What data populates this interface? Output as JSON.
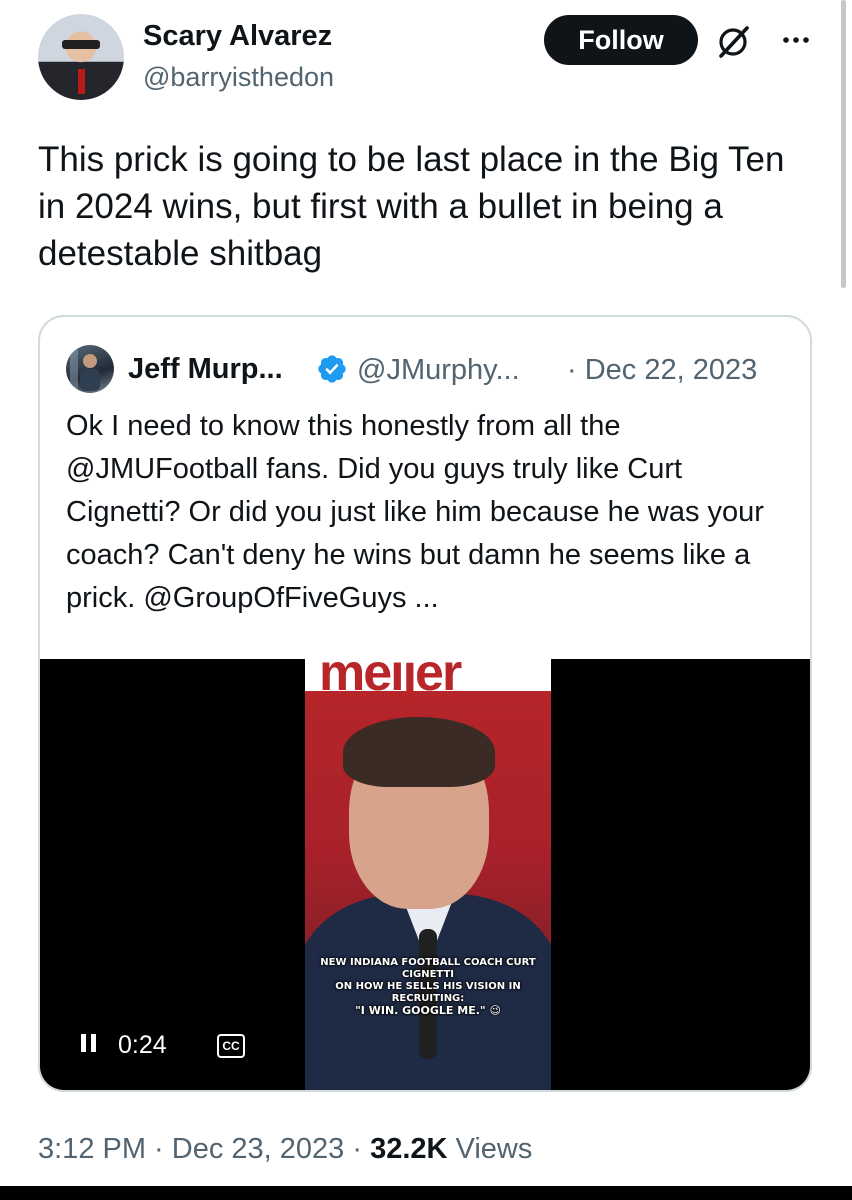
{
  "author": {
    "name": "Scary Alvarez",
    "handle": "@barryisthedon",
    "avatar_icon": "profile-photo-avatar"
  },
  "header_actions": {
    "follow_label": "Follow",
    "grok_icon": "grok-slash-circle-icon",
    "more_icon": "more-dots-icon"
  },
  "tweet": {
    "text": "This prick is going to be last place in the Big Ten in 2024 wins, but first with a bullet in being a detestable shitbag"
  },
  "quoted": {
    "name": "Jeff Murp...",
    "verified_icon": "verified-badge-icon",
    "handle": "@JMurphy...",
    "date": "· Dec 22, 2023",
    "text": "Ok I need to know this honestly from all the @JMUFootball fans. Did you guys truly like Curt Cignetti? Or did you just like him because he was your coach? Can't deny he wins but damn he seems like a prick.  @GroupOfFiveGuys ...",
    "video": {
      "banner_text": "meijer",
      "caption_line1": "NEW INDIANA FOOTBALL COACH CURT CIGNETTI",
      "caption_line2": "ON HOW HE SELLS HIS VISION IN RECRUITING:",
      "caption_line3": "\"I WIN. GOOGLE ME.\" 😉",
      "pause_icon": "pause-icon",
      "time": "0:24",
      "cc_label": "CC"
    }
  },
  "footer": {
    "time_date": "3:12 PM · Dec 23, 2023 · ",
    "views_count": "32.2K",
    "views_label": " Views"
  },
  "colors": {
    "text": "#0f1419",
    "secondary": "#536471",
    "verified": "#1d9bf0",
    "border": "#cfd9de"
  }
}
